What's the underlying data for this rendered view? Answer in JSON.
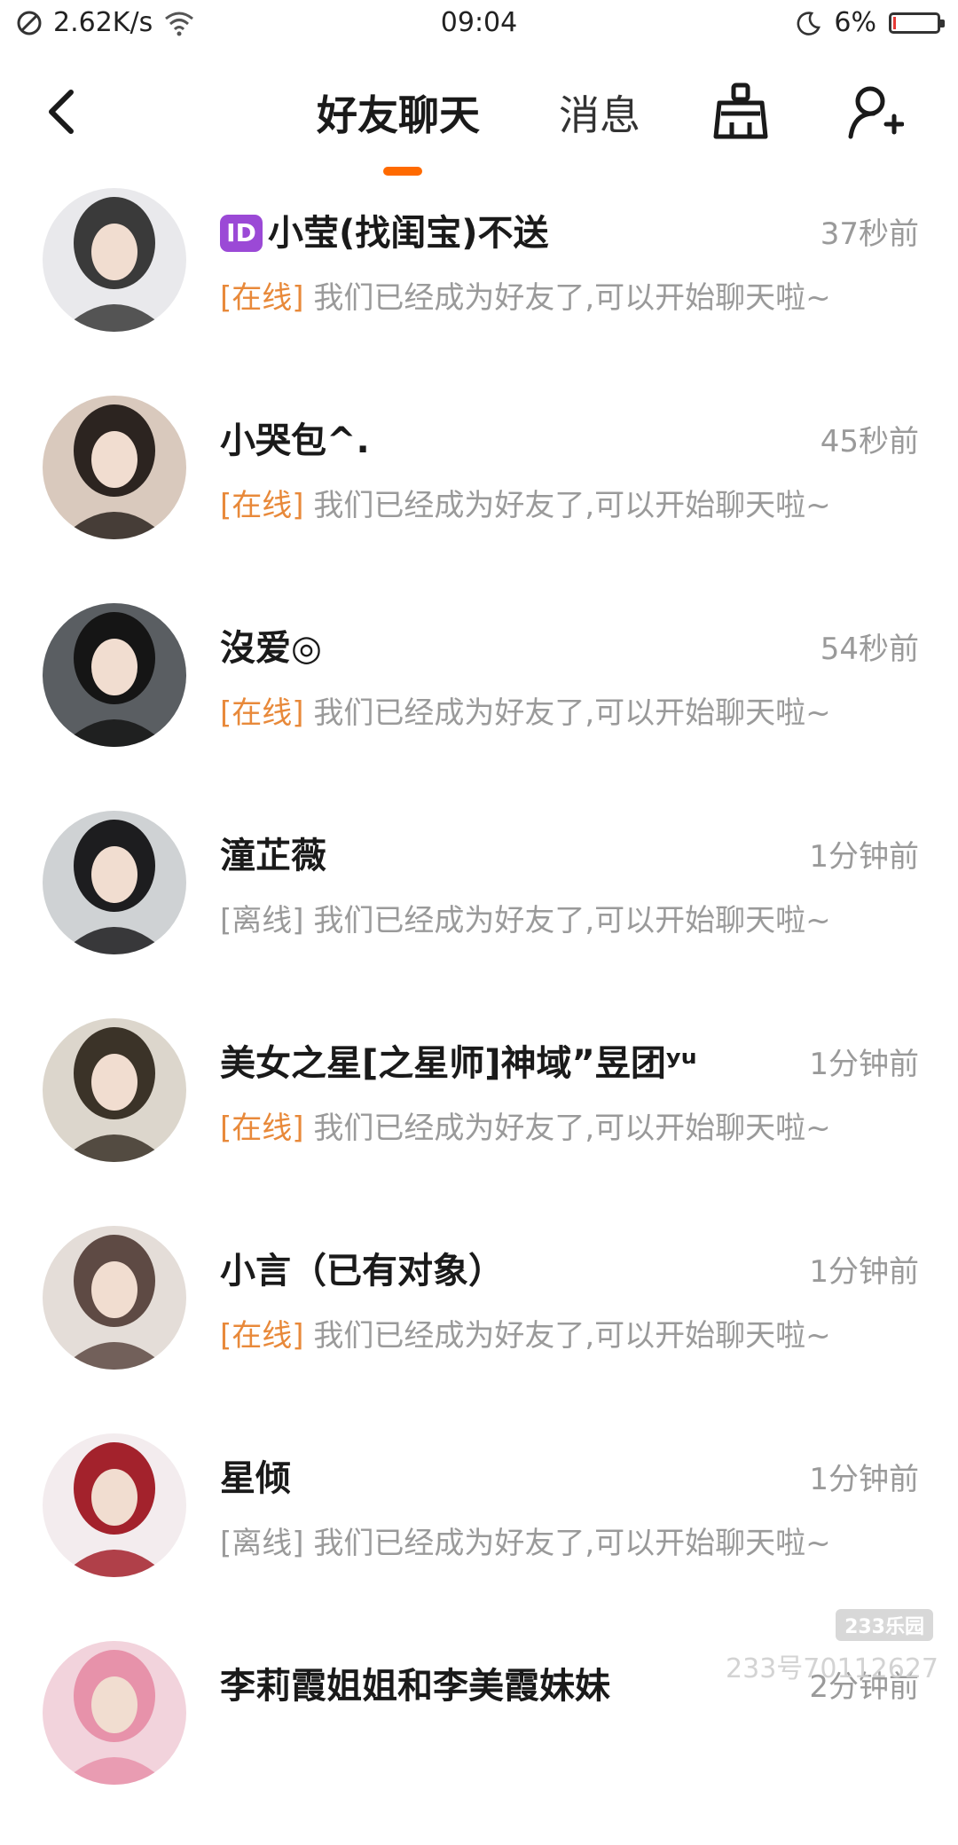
{
  "status_bar": {
    "speed": "2.62K/s",
    "time": "09:04",
    "battery_pct": "6%",
    "battery_level": 0.06,
    "battery_color": "#e53935"
  },
  "nav": {
    "back_icon": "chevron-left-icon",
    "tabs": [
      {
        "label": "好友聊天",
        "active": true
      },
      {
        "label": "消息",
        "active": false
      }
    ],
    "accent_color": "#ff6a00",
    "clean_icon": "broom-icon",
    "add_friend_icon": "add-user-icon"
  },
  "chats": [
    {
      "badge": "ID",
      "name": "小莹(找闺宝)不送",
      "time": "37秒前",
      "status": "[在线]",
      "online": true,
      "message": "我们已经成为好友了,可以开始聊天啦~",
      "avatar_colors": [
        "#e9e9ec",
        "#3a3a3a"
      ]
    },
    {
      "badge": "",
      "name": "小哭包^.",
      "time": "45秒前",
      "status": "[在线]",
      "online": true,
      "message": "我们已经成为好友了,可以开始聊天啦~",
      "avatar_colors": [
        "#d9c9bd",
        "#2c2420"
      ]
    },
    {
      "badge": "",
      "name": "沒爱◎",
      "time": "54秒前",
      "status": "[在线]",
      "online": true,
      "message": "我们已经成为好友了,可以开始聊天啦~",
      "avatar_colors": [
        "#5a5e62",
        "#151515"
      ]
    },
    {
      "badge": "",
      "name": "潼芷薇",
      "time": "1分钟前",
      "status": "[离线]",
      "online": false,
      "message": "我们已经成为好友了,可以开始聊天啦~",
      "avatar_colors": [
        "#cfd2d4",
        "#1d1d1f"
      ]
    },
    {
      "badge": "",
      "name": "美女之星[之星师]神域”昱团ʸᵘ",
      "time": "1分钟前",
      "status": "[在线]",
      "online": true,
      "message": "我们已经成为好友了,可以开始聊天啦~",
      "avatar_colors": [
        "#dcd6cc",
        "#3b3328"
      ]
    },
    {
      "badge": "",
      "name": "小言（已有对象）",
      "time": "1分钟前",
      "status": "[在线]",
      "online": true,
      "message": "我们已经成为好友了,可以开始聊天啦~",
      "avatar_colors": [
        "#e4ddd8",
        "#5e4a44"
      ]
    },
    {
      "badge": "",
      "name": "星倾",
      "time": "1分钟前",
      "status": "[离线]",
      "online": false,
      "message": "我们已经成为好友了,可以开始聊天啦~",
      "avatar_colors": [
        "#f3ecee",
        "#a3222c"
      ]
    },
    {
      "badge": "",
      "name": "李莉霞姐姐和李美霞妹妹",
      "time": "2分钟前",
      "status": "",
      "online": false,
      "message": "",
      "avatar_colors": [
        "#f2d3dc",
        "#e792aa"
      ]
    }
  ],
  "watermark": {
    "logo": "233乐园",
    "text": "233号70112627"
  }
}
